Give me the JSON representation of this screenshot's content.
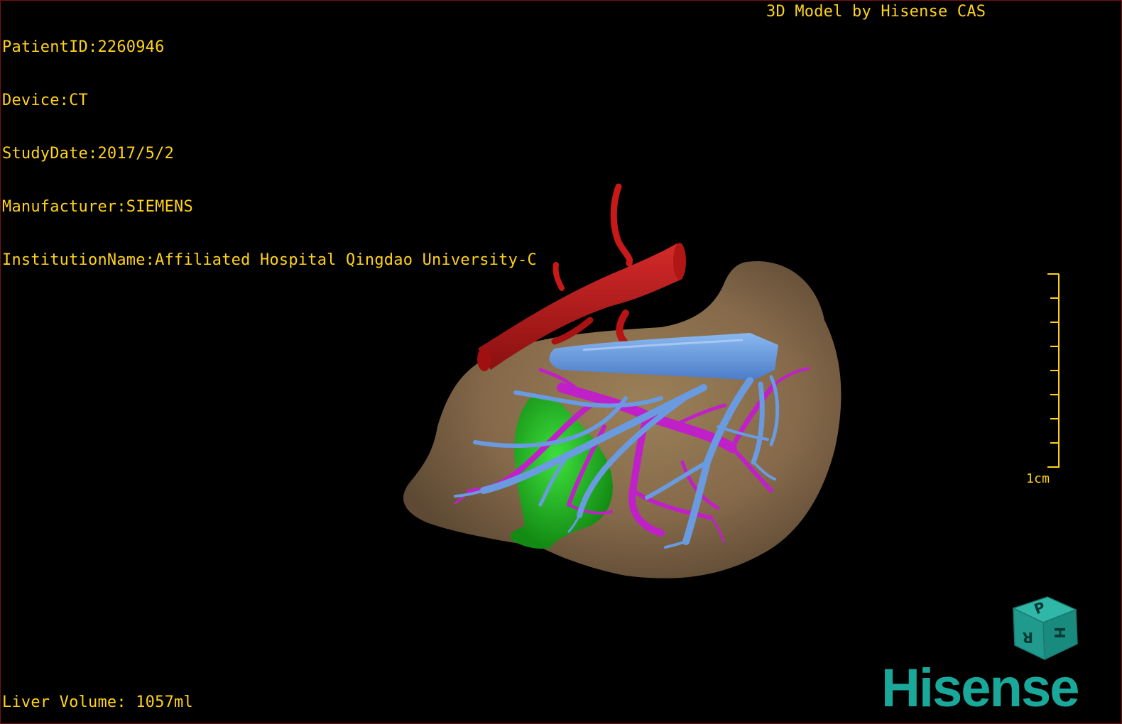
{
  "study_info": {
    "patient_id": "PatientID:2260946",
    "device": "Device:CT",
    "study_date": "StudyDate:2017/5/2",
    "manufacturer": "Manufacturer:SIEMENS",
    "institution": "InstitutionName:Affiliated Hospital Qingdao University-C"
  },
  "credit": "3D Model by Hisense CAS",
  "liver_volume": "Liver Volume: 1057ml",
  "scale": {
    "label": "1cm"
  },
  "orientation_cube": {
    "visible_faces": [
      "P",
      "H",
      "R"
    ]
  },
  "brand": "Hisense",
  "colors": {
    "overlay_text": "#ffd21a",
    "liver": "#8a7050",
    "hepatic_vein": "#6a9ae0",
    "portal_vein": "#c020c8",
    "vena_cava_artery": "#c81818",
    "lesion": "#22b822",
    "brand": "#1aa89a"
  },
  "icons": [
    "orientation-cube-icon",
    "hisense-logo"
  ]
}
